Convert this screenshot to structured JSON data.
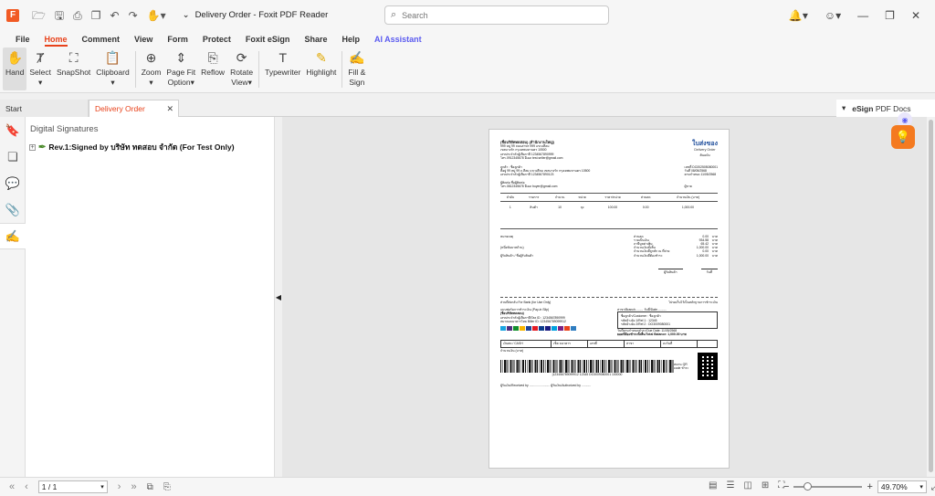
{
  "app": {
    "title": "Delivery Order - Foxit PDF Reader",
    "logo_letter": "F",
    "accent": "#e8421b"
  },
  "search": {
    "placeholder": "Search"
  },
  "menu": [
    "File",
    "Home",
    "Comment",
    "View",
    "Form",
    "Protect",
    "Foxit eSign",
    "Share",
    "Help",
    "AI Assistant"
  ],
  "menu_active": "Home",
  "ribbon": {
    "hand": "Hand",
    "select": "Select",
    "snapshot": "SnapShot",
    "clipboard": "Clipboard",
    "zoom": "Zoom",
    "page_fit_1": "Page Fit",
    "page_fit_2": "Option",
    "reflow": "Reflow",
    "rotate_1": "Rotate",
    "rotate_2": "View",
    "typewriter": "Typewriter",
    "highlight": "Highlight",
    "fill_sign_1": "Fill &",
    "fill_sign_2": "Sign"
  },
  "tabs": {
    "start": "Start",
    "current": "Delivery Order"
  },
  "esign": {
    "brand": "eSign",
    "rest": "PDF Docs"
  },
  "panel": {
    "title": "Digital Signatures",
    "signature": "Rev.1:Signed by บริษัท ทดสอบ จำกัด (For Test Only)"
  },
  "doc": {
    "company": "(ชื่อบริษัททดสอบ) (สำนักงานใหญ่)",
    "addr1": "999 หมู่ 99 ถนนสาทร 999 แขวงสีลม",
    "addr2": "เขตบางรัก กรุงเทพมหานคร 10500",
    "taxid": "เลขประจำตัวผู้เสียภาษี 1234567890999",
    "contact": "โทร.0912345678 อีเมล test.seller@gmail.com",
    "title_th": "ใบส่งของ",
    "title_en": "Delivery Order",
    "copy": "ต้นฉบับ",
    "customer": "ลูกค้า : ชื่อลูกค้า",
    "cust_addr": "ที่อยู่ 99 หมู่ 99 ถ.สีลม แขวงสีลม เขตบางรัก กรุงเทพมหานคร 10500",
    "cust_tax": "เลขประจำตัวผู้เสียภาษี 1234567890123",
    "doc_no": "เลขที่ DO202505080001",
    "date": "วันที่ 08/05/2568",
    "due": "ครบกำหนด 11/05/2568",
    "contact_name": "ผู้ติดต่อ ชื่อผู้ติดต่อ",
    "contact_tel": "โทร.0812345678 อีเมล buyer@gmail.com",
    "seller": "ผู้ขาย",
    "cols": [
      "ลำดับ",
      "รายการ",
      "จำนวน",
      "หน่วย",
      "ราคา/หน่วย",
      "ส่วนลด",
      "จำนวนเงิน (บาท)"
    ],
    "row": [
      "1",
      "สินค้า",
      "10",
      "ถุง",
      "100.00",
      "0.00",
      "1,000.00"
    ],
    "notes": "หมายเหตุ",
    "amount_words": "(หนึ่งพันบาทถ้วน)",
    "signer": "ผู้รับสินค้า / ชื่อผู้รับสินค้า",
    "totals": [
      [
        "ส่วนลด",
        "0.00",
        "บาท"
      ],
      [
        "รวมเป็นเงิน",
        "934.58",
        "บาท"
      ],
      [
        "ภาษีมูลค่าเพิ่ม",
        "65.42",
        "บาท"
      ],
      [
        "จำนวนเงินทั้งสิ้น",
        "1,000.00",
        "บาท"
      ],
      [
        "จำนวนเงินที่ถูกหัก ณ ที่จ่าย",
        "0.00",
        "บาท"
      ],
      [
        "จำนวนเงินที่ต้องชำระ",
        "1,000.00",
        "บาท"
      ]
    ],
    "auth_sign": "ผู้รับสินค้า",
    "auth_date": "วันที่",
    "cut_left": "ส่วนที่ส่งกลับ For Bank (for Use Only)",
    "cut_right": "โปรดเก็บไว้เป็นหลักฐานการชำระเงิน",
    "payin": "แบบฟอร์มการชำระเงิน (Pay-in Slip)",
    "payin_company": "(ชื่อบริษัททดสอบ)",
    "payin_tax": "เลขประจำตัวผู้เสียภาษี/Tax ID : 1234567890999",
    "payin_biller": "สมาคมธนาคารไทย Biller ID: 123456789099912",
    "branch": "สาขา/Branch......... วันที่/Date...........",
    "box": [
      "ชื่อลูกค้า/Customer : ชื่อลูกค้า",
      "รหัสอ้างอิง 1/Ref.1 : 12345",
      "รหัสอ้างอิง 2/Ref.2 : DO3009080001"
    ],
    "duedate": "วันที่ครบกำหนดชำระ/Due Date: 11/05/2568",
    "balance": "ยอดที่ต้องชำระทั้งสิ้น/Total Balance: 1,000.00 บาท",
    "cash": [
      "เงินสด / CASH",
      "เช็ค ธนาคาร",
      "เลขที่",
      "สาขา",
      "ลงวันที่"
    ],
    "amount_label": "จำนวนเงิน (บาท)",
    "qr_label": "สแกน QR code ชำระ",
    "barcode_txt": "|123456789099912 12345 DO3009080001 100000",
    "footer": "ผู้รับเงิน/Received by ........................  ผู้รับเงิน/Authorized by ..........."
  },
  "status": {
    "page": "1 / 1",
    "zoom": "49.70%",
    "zoom_fraction": 0.2
  }
}
